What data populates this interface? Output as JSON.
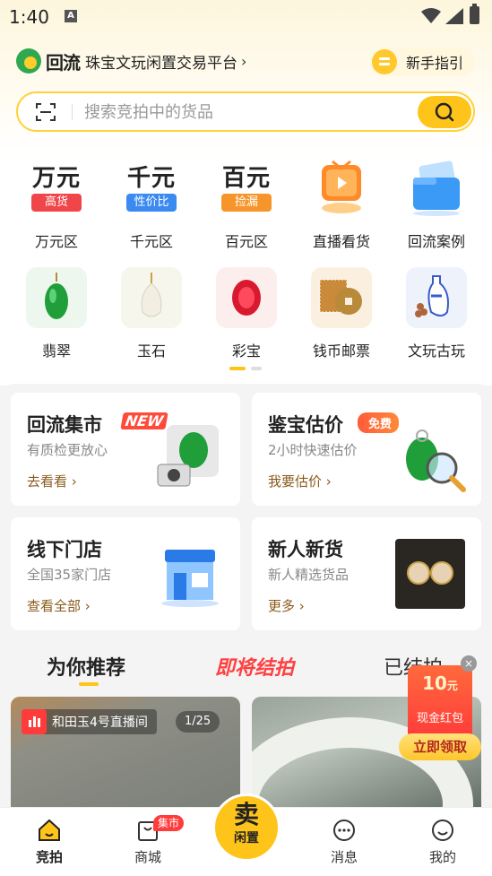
{
  "status_bar": {
    "time": "1:40",
    "notif_icon": "A"
  },
  "header": {
    "brand_name": "回流",
    "slogan": "珠宝文玩闲置交易平台",
    "guide_label": "新手指引"
  },
  "search": {
    "placeholder": "搜索竞拍中的货品"
  },
  "price_categories": [
    {
      "big": "万元",
      "tag": "高货",
      "tag_color": "#f0464a",
      "label": "万元区"
    },
    {
      "big": "千元",
      "tag": "性价比",
      "tag_color": "#3a8af0",
      "label": "千元区"
    },
    {
      "big": "百元",
      "tag": "捡漏",
      "tag_color": "#f5952a",
      "label": "百元区"
    }
  ],
  "icon_categories_row1": [
    {
      "label": "直播看货",
      "icon": "tv-play-icon"
    },
    {
      "label": "回流案例",
      "icon": "folder-card-icon"
    }
  ],
  "icon_categories_row2": [
    {
      "label": "翡翠",
      "icon": "jade-pendant-icon"
    },
    {
      "label": "玉石",
      "icon": "white-jade-icon"
    },
    {
      "label": "彩宝",
      "icon": "ruby-icon"
    },
    {
      "label": "钱币邮票",
      "icon": "coin-stamp-icon"
    },
    {
      "label": "文玩古玩",
      "icon": "antique-vase-icon"
    }
  ],
  "cards": {
    "market": {
      "title": "回流集市",
      "badge": "NEW",
      "sub": "有质检更放心",
      "link": "去看看 ›"
    },
    "appraise": {
      "title": "鉴宝估价",
      "badge": "免费",
      "sub": "2小时快速估价",
      "link": "我要估价 ›"
    },
    "stores": {
      "title": "线下门店",
      "sub": "全国35家门店",
      "link": "查看全部 ›"
    },
    "newbie": {
      "title": "新人新货",
      "sub": "新人精选货品",
      "link": "更多 ›"
    }
  },
  "rec_tabs": {
    "recommend": "为你推荐",
    "auction": "即将结拍",
    "ended": "已结拍"
  },
  "feed": {
    "live_title": "和田玉4号直播间",
    "page": "1/25"
  },
  "promo": {
    "amount": "10",
    "unit": "元",
    "label": "现金红包",
    "button": "立即领取",
    "close": "×"
  },
  "bottom_nav": {
    "bid": "竞拍",
    "mall": "商城",
    "mall_badge": "集市",
    "sell_big": "卖",
    "sell_small": "闲置",
    "messages": "消息",
    "mine": "我的"
  }
}
